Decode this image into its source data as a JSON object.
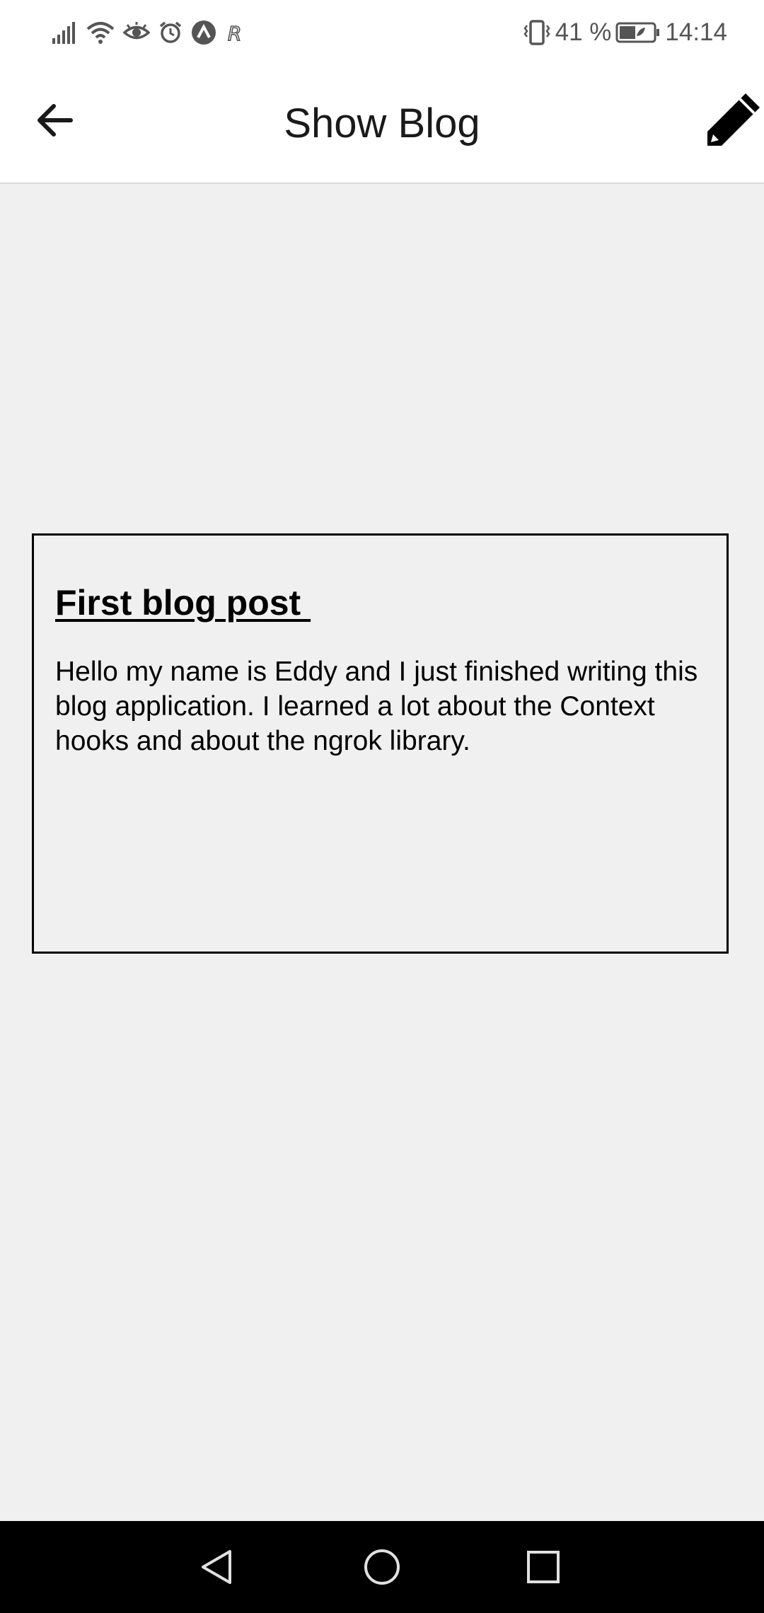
{
  "status_bar": {
    "battery_percent": "41 %",
    "time": "14:14",
    "left_icons": [
      "signal-icon",
      "wifi-icon",
      "eye-icon",
      "alarm-icon",
      "arrow-up-badge-icon",
      "r-badge-icon"
    ],
    "right_icons": [
      "vibrate-icon",
      "battery-icon"
    ]
  },
  "app_bar": {
    "title": "Show Blog",
    "back_icon": "arrow-left-icon",
    "edit_icon": "pencil-icon"
  },
  "blog": {
    "title": "First blog post ",
    "content": "Hello my name is Eddy and I just finished writing this blog application. I learned a lot about the Context hooks and about the ngrok library."
  },
  "nav_bar": {
    "icons": [
      "back-triangle-icon",
      "home-circle-icon",
      "recents-square-icon"
    ]
  },
  "colors": {
    "background": "#f0f0f0",
    "header_background": "#ffffff",
    "text": "#000000",
    "status_text": "#555555",
    "nav_bar": "#000000"
  }
}
